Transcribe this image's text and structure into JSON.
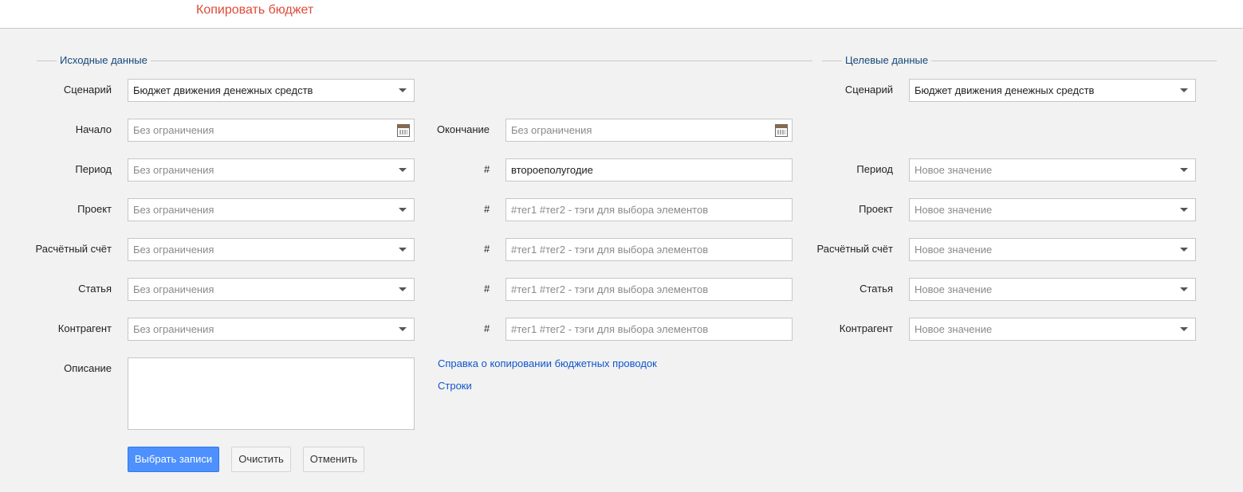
{
  "header": {
    "title": "Копировать бюджет"
  },
  "source": {
    "legend": "Исходные данные",
    "scenario": {
      "label": "Сценарий",
      "value": "Бюджет движения денежных средств"
    },
    "start": {
      "label": "Начало",
      "placeholder": "Без ограничения"
    },
    "end": {
      "label": "Окончание",
      "placeholder": "Без ограничения"
    },
    "rows": [
      {
        "label": "Период",
        "placeholder": "Без ограничения",
        "hash": "#",
        "tag_value": "второеполугодие",
        "tag_placeholder": ""
      },
      {
        "label": "Проект",
        "placeholder": "Без ограничения",
        "hash": "#",
        "tag_value": "",
        "tag_placeholder": "#тег1 #тег2 - тэги для выбора элементов"
      },
      {
        "label": "Расчётный счёт",
        "placeholder": "Без ограничения",
        "hash": "#",
        "tag_value": "",
        "tag_placeholder": "#тег1 #тег2 - тэги для выбора элементов"
      },
      {
        "label": "Статья",
        "placeholder": "Без ограничения",
        "hash": "#",
        "tag_value": "",
        "tag_placeholder": "#тег1 #тег2 - тэги для выбора элементов"
      },
      {
        "label": "Контрагент",
        "placeholder": "Без ограничения",
        "hash": "#",
        "tag_value": "",
        "tag_placeholder": "#тег1 #тег2 - тэги для выбора элементов"
      }
    ],
    "description": {
      "label": "Описание"
    }
  },
  "target": {
    "legend": "Целевые данные",
    "scenario": {
      "label": "Сценарий",
      "value": "Бюджет движения денежных средств"
    },
    "rows": [
      {
        "label": "Период",
        "placeholder": "Новое значение"
      },
      {
        "label": "Проект",
        "placeholder": "Новое значение"
      },
      {
        "label": "Расчётный счёт",
        "placeholder": "Новое значение"
      },
      {
        "label": "Статья",
        "placeholder": "Новое значение"
      },
      {
        "label": "Контрагент",
        "placeholder": "Новое значение"
      }
    ]
  },
  "links": {
    "help": "Справка о копировании бюджетных проводок",
    "rows": "Строки"
  },
  "buttons": {
    "select": "Выбрать записи",
    "clear": "Очистить",
    "cancel": "Отменить"
  },
  "colors": {
    "title": "#dd4b39",
    "legend": "#15497a",
    "link": "#1155cc",
    "primary_button": "#4d90fe"
  }
}
